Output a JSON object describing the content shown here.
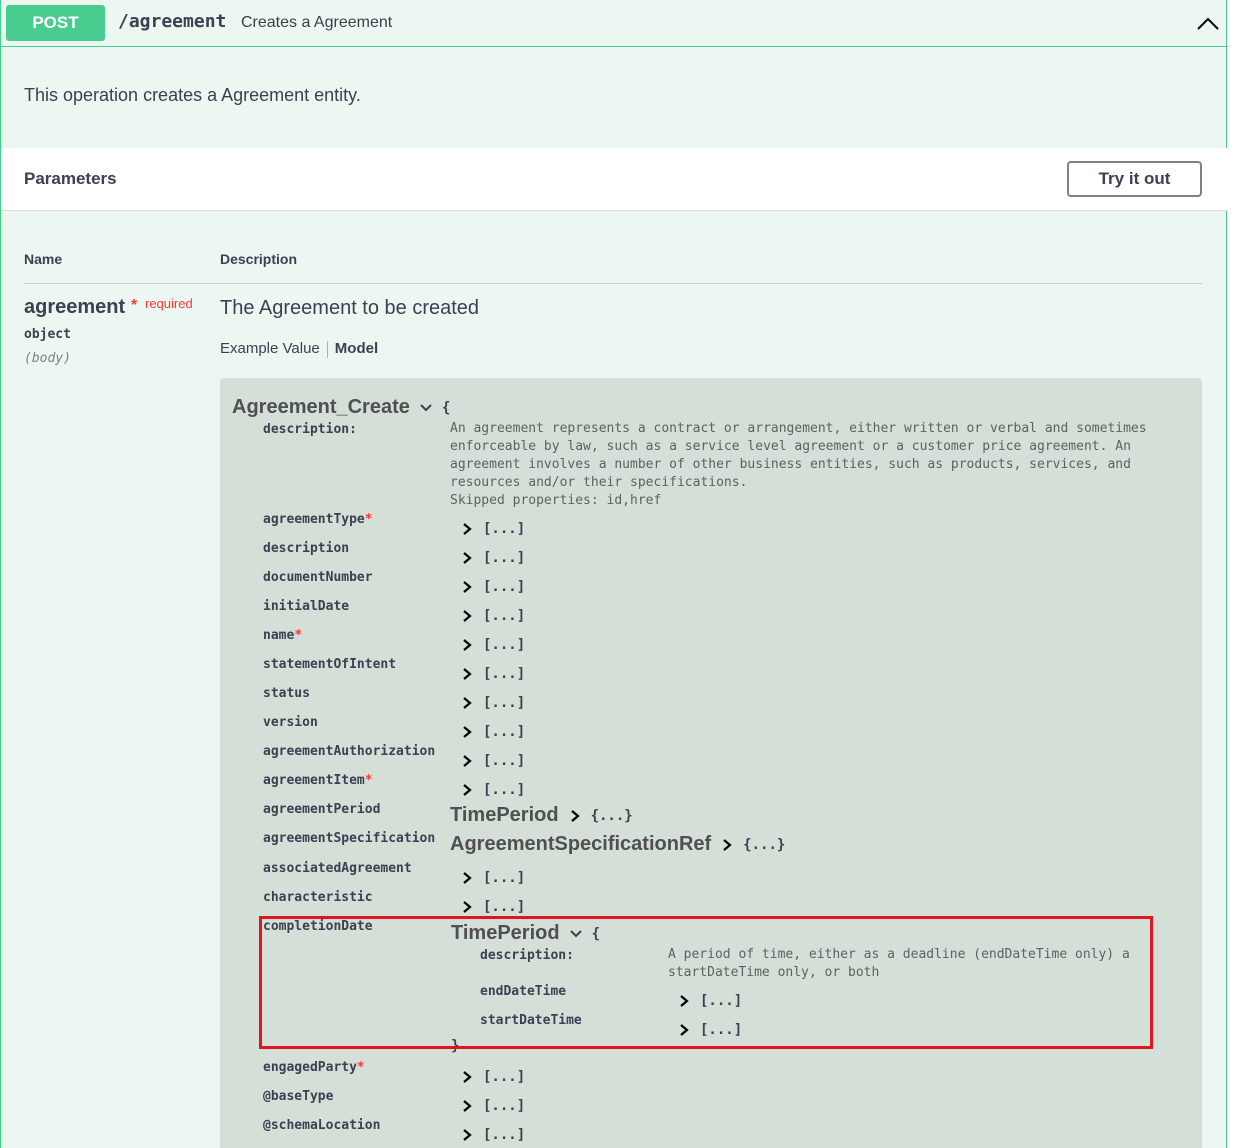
{
  "summary": {
    "method": "POST",
    "path": "/agreement",
    "description": "Creates a Agreement"
  },
  "operation_description": "This operation creates a Agreement entity.",
  "parameters": {
    "title": "Parameters",
    "try_button": "Try it out",
    "col_name": "Name",
    "col_description": "Description"
  },
  "param": {
    "name": "agreement",
    "star": "*",
    "required": "required",
    "type": "object",
    "in": "(body)",
    "description": "The Agreement to be created",
    "tab_example": "Example Value",
    "tab_model": "Model"
  },
  "model": {
    "name": "Agreement_Create",
    "open_brace": "{",
    "close_brace": "}",
    "description_label": "description:",
    "description": "An agreement represents a contract or arrangement, either written or verbal and sometimes\nenforceable by law, such as a service level agreement or a customer price agreement. An\nagreement involves a number of other business entities, such as products, services, and\nresources and/or their specifications.\nSkipped properties: id,href",
    "collapsed_array": "[...]",
    "collapsed_object": "{...}",
    "properties": [
      {
        "name": "agreementType",
        "required": true
      },
      {
        "name": "description",
        "required": false
      },
      {
        "name": "documentNumber",
        "required": false
      },
      {
        "name": "initialDate",
        "required": false
      },
      {
        "name": "name",
        "required": true
      },
      {
        "name": "statementOfIntent",
        "required": false
      },
      {
        "name": "status",
        "required": false
      },
      {
        "name": "version",
        "required": false
      },
      {
        "name": "agreementAuthorization",
        "required": false
      },
      {
        "name": "agreementItem",
        "required": true
      },
      {
        "name": "agreementPeriod",
        "required": false,
        "ref": "TimePeriod"
      },
      {
        "name": "agreementSpecification",
        "required": false,
        "ref": "AgreementSpecificationRef"
      },
      {
        "name": "associatedAgreement",
        "required": false
      },
      {
        "name": "characteristic",
        "required": false
      },
      {
        "name": "completionDate",
        "required": false
      },
      {
        "name": "engagedParty",
        "required": true
      },
      {
        "name": "@baseType",
        "required": false
      },
      {
        "name": "@schemaLocation",
        "required": false
      }
    ],
    "required_star": "*",
    "completion": {
      "ref": "TimePeriod",
      "open_brace": "{",
      "description_label": "description:",
      "description": "A period of time, either as a deadline (endDateTime only) a\nstartDateTime only, or both",
      "props": [
        "endDateTime",
        "startDateTime"
      ]
    }
  },
  "colors": {
    "post": "#49cc90",
    "highlight": "#e0151d",
    "required": "#ff3838"
  }
}
